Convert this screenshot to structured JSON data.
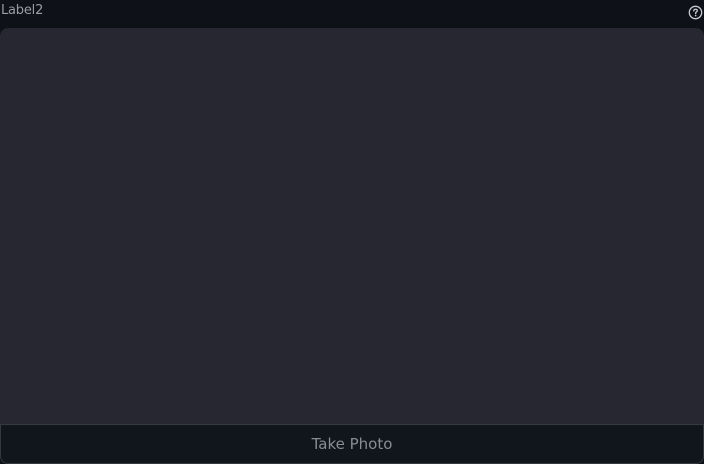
{
  "camera_input": {
    "label": "Label2",
    "help_icon": "question-circle-icon",
    "button_label": "Take Photo"
  },
  "colors": {
    "background": "#0e1117",
    "frame": "#262730",
    "label_text": "#9a9ca3",
    "button_text": "#8a8c93"
  }
}
